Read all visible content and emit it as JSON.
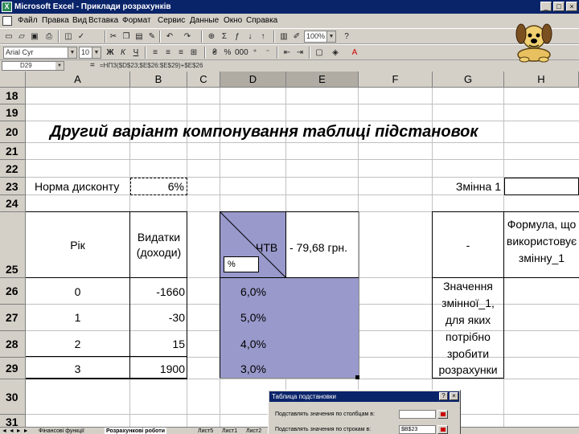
{
  "window": {
    "title": "Microsoft Excel - Приклади розрахунків",
    "app_icon": "excel-icon",
    "minimize": "_",
    "restore": "□",
    "close": "×"
  },
  "menu": {
    "items": [
      "Файл",
      "Правка",
      "Вид",
      "Вставка",
      "Формат",
      "Сервис",
      "Данные",
      "Окно",
      "Справка"
    ]
  },
  "toolbar1": {
    "zoom": "100%",
    "help": "?"
  },
  "toolbar2": {
    "font": "Arial Cyr",
    "font_size": "10"
  },
  "formula_bar": {
    "name_box": "D29",
    "equals": "=",
    "formula": "=НПЗ($D$23;$E$26:$E$29)+$E$26"
  },
  "columns": [
    {
      "label": "A",
      "selected": false
    },
    {
      "label": "B",
      "selected": false
    },
    {
      "label": "C",
      "selected": false
    },
    {
      "label": "D",
      "selected": true
    },
    {
      "label": "E",
      "selected": true
    },
    {
      "label": "F",
      "selected": false
    },
    {
      "label": "G",
      "selected": false
    },
    {
      "label": "H",
      "selected": false
    }
  ],
  "rows": [
    "18",
    "19",
    "20",
    "21",
    "22",
    "23",
    "24",
    "25",
    "26",
    "27",
    "28",
    "29",
    "30",
    "31"
  ],
  "sheet": {
    "title": "Другий варіант компонування таблиці підстановок",
    "discount_label": "Норма дисконту",
    "discount_value": "6%",
    "variable_label": "Змінна 1",
    "year_header": "Рік",
    "expense_header_line1": "Видатки",
    "expense_header_line2": "(доходи)",
    "npv_label": "ЧТВ",
    "npv_value": "-  79,68 грн.",
    "percent_label": "%",
    "dash": "-",
    "formula_header_line1": "Формула, що",
    "formula_header_line2": "використовує",
    "formula_header_line3": "змінну_1",
    "values_label_lines": [
      "Значення",
      "змінної_1,",
      "для яких",
      "потрібно",
      "зробити",
      "розрахунки"
    ],
    "years": [
      "0",
      "1",
      "2",
      "3"
    ],
    "amounts": [
      "-1660",
      "-30",
      "15",
      "1900"
    ],
    "rates": [
      "6,0%",
      "5,0%",
      "4,0%",
      "3,0%"
    ],
    "shade_color": "#9999cc"
  },
  "tabs": {
    "nav": "◄ ◄ ► ►",
    "items": [
      "Фінансові функції",
      "Розрахункові роботи",
      "Лист5",
      "Лист1",
      "Лист2"
    ]
  },
  "dialog": {
    "title": "Таблица подстановки",
    "help": "?",
    "close": "×",
    "row_label": "Подставлять значения по столбцам в:",
    "col_label": "Подставлять значения по строкам в:",
    "col_value": "$B$23"
  }
}
